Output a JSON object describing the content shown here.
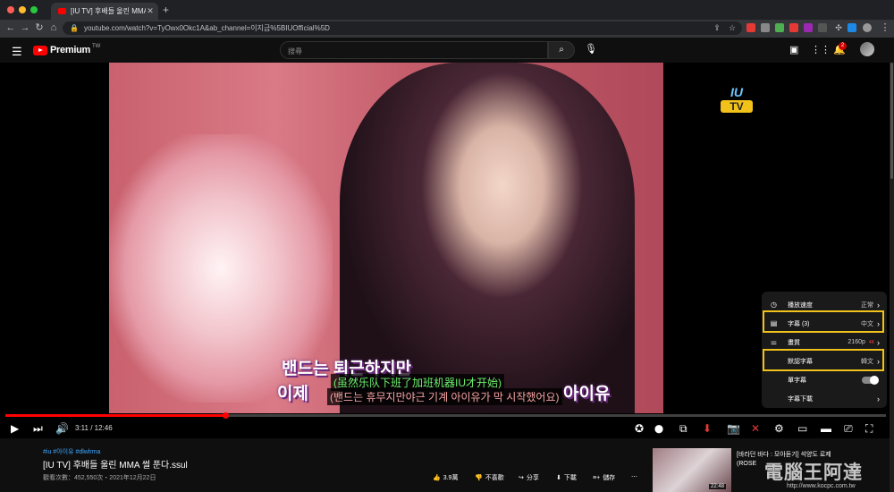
{
  "browser": {
    "tab_title": "[IU TV] 후배들 울린 MMA 썰 푼다.",
    "url": "youtube.com/watch?v=TyOwx0Okc1A&ab_channel=이지금%5BIUOfficial%5D"
  },
  "header": {
    "logo_text": "Premium",
    "region": "TW",
    "search_placeholder": "搜尋",
    "notification_count": "2"
  },
  "video": {
    "watermark_line1": "IU",
    "watermark_line2": "TV",
    "burned_sub_line1": "밴드는 퇴근하지만",
    "burned_sub_line2_left": "이제",
    "burned_sub_line2_right": "아이유",
    "caption_zh": "(虽然乐队下班了加班机器IU才开始)",
    "caption_kr": "(밴드는 휴무지만야근 기계 아이유가 막 시작했어요)",
    "current_time": "3:11",
    "duration": "12:46",
    "progress": 0.25
  },
  "settings_menu": {
    "items": [
      {
        "label": "播放速度",
        "value": "正常"
      },
      {
        "label": "字幕 (3)",
        "value": "中文"
      },
      {
        "label": "畫質",
        "value": "2160p",
        "badge": "4K"
      },
      {
        "label": "默認字幕",
        "value": "韓文"
      },
      {
        "label": "單字幕",
        "value": ""
      },
      {
        "label": "字幕下載",
        "value": ""
      }
    ]
  },
  "below": {
    "tags": "#iu #아이유 #dlwlrma",
    "title": "[IU TV] 후배들 울린 MMA 썰 푼다.ssul",
    "meta": "觀看次數：452,550次・2021年12月22日",
    "actions": {
      "likes": "3.9萬",
      "dislike": "不喜歡",
      "share": "分享",
      "download": "下載",
      "save": "儲存"
    },
    "rec_title_1": "[바라던 바다 : 모아듣기] 석양도 로제",
    "rec_title_2": "(ROSE",
    "rec_duration": "22:48"
  },
  "site_watermark": {
    "text": "電腦王阿達",
    "url": "http://www.kocpc.com.tw"
  },
  "colors": {
    "accent": "#ff0000",
    "highlight": "#f2c21b",
    "caption_zh": "#6cf06c",
    "caption_kr": "#f5a3a3",
    "link": "#3ea6ff"
  }
}
